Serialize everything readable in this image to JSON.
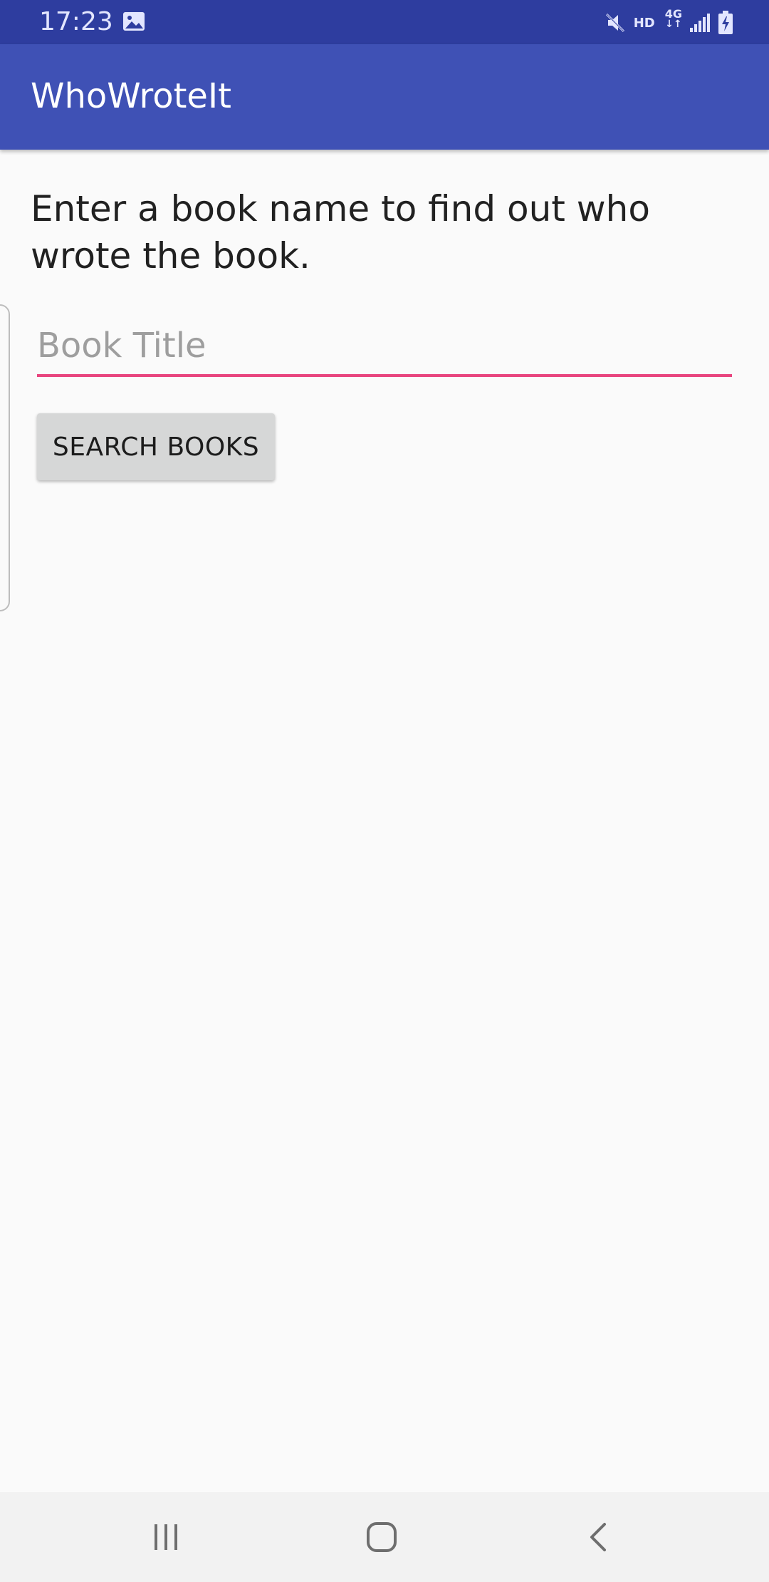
{
  "status_bar": {
    "time": "17:23",
    "network_badge": "HD",
    "network_type": "4G",
    "network_arrows": "↓↑",
    "icons": [
      "gallery-icon",
      "mute-icon",
      "signal-icon",
      "battery-charging-icon"
    ]
  },
  "app_bar": {
    "title": "WhoWroteIt",
    "color": "#3f51b5"
  },
  "main": {
    "instructions": "Enter a book name to find out who wrote the book.",
    "book_input": {
      "value": "",
      "placeholder": "Book Title",
      "underline_color": "#e8457e"
    },
    "search_button": {
      "label": "SEARCH BOOKS"
    }
  },
  "nav_bar": {
    "icons": [
      "recents-icon",
      "home-icon",
      "back-icon"
    ]
  },
  "colors": {
    "status_bar": "#2e3d9f",
    "app_bar": "#3f51b5",
    "accent": "#e8457e",
    "background": "#fafafa",
    "button": "#d6d7d7"
  }
}
